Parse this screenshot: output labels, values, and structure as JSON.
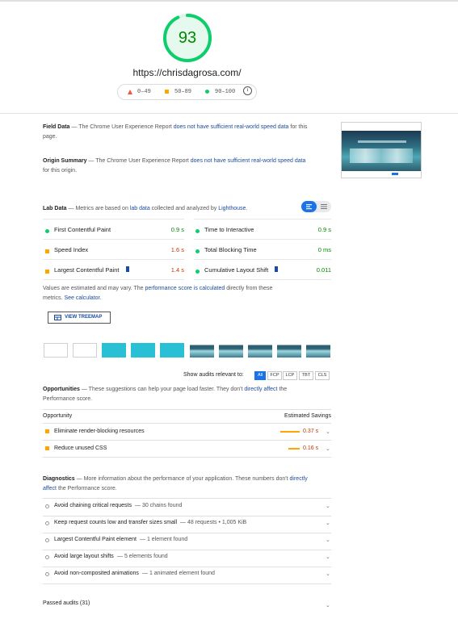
{
  "score": {
    "value": "93",
    "percent": 0.93,
    "color": "#0cce6b"
  },
  "page_url": "https://chrisdagrosa.com/",
  "legend": {
    "fail": "0–49",
    "average": "50–89",
    "pass": "90–100",
    "info_icon": "info-icon"
  },
  "field_data": {
    "title": "Field Data",
    "dash": "—",
    "text": "The Chrome User Experience Report",
    "link": "does not have sufficient real-world speed data",
    "tail": "for this page."
  },
  "origin_summary": {
    "title": "Origin Summary",
    "dash": "—",
    "text": "The Chrome User Experience Report",
    "link": "does not have sufficient real-world speed data",
    "tail": "for this origin."
  },
  "lab_data": {
    "title": "Lab Data",
    "dash": "—",
    "text": "Metrics are based on",
    "link1": "lab data",
    "mid": "collected and analyzed by",
    "link2": "Lighthouse",
    "end": "."
  },
  "metrics": [
    {
      "label": "First Contentful Paint",
      "value": "0.9 s",
      "status": "pass"
    },
    {
      "label": "Time to Interactive",
      "value": "0.9 s",
      "status": "pass"
    },
    {
      "label": "Speed Index",
      "value": "1.6 s",
      "status": "average"
    },
    {
      "label": "Total Blocking Time",
      "value": "0 ms",
      "status": "pass"
    },
    {
      "label": "Largest Contentful Paint",
      "value": "1.4 s",
      "status": "average"
    },
    {
      "label": "Cumulative Layout Shift",
      "value": "0.011",
      "status": "pass"
    }
  ],
  "estimate_note": {
    "a": "Values are estimated and may vary. The",
    "link1": "performance score is calculated",
    "b": "directly from these",
    "c": "metrics.",
    "link2": "See calculator."
  },
  "treemap_button": "VIEW TREEMAP",
  "filter": {
    "label": "Show audits relevant to:",
    "options": [
      "All",
      "FCP",
      "LCP",
      "TBT",
      "CLS"
    ],
    "selected": "All"
  },
  "opportunities": {
    "title": "Opportunities",
    "dash": "—",
    "text": "These suggestions can help your page load faster. They don't",
    "link": "directly affect",
    "tail": "the",
    "tail2": "Performance score.",
    "col_opportunity": "Opportunity",
    "col_savings": "Estimated Savings",
    "items": [
      {
        "label": "Eliminate render-blocking resources",
        "savings": "0.37 s"
      },
      {
        "label": "Reduce unused CSS",
        "savings": "0.16 s"
      }
    ]
  },
  "diagnostics": {
    "title": "Diagnostics",
    "dash": "—",
    "text": "More information about the performance of your application. These numbers don't",
    "link": "directly",
    "link2": "affect",
    "tail": "the Performance score.",
    "items": [
      {
        "label": "Avoid chaining critical requests",
        "detail": "— 30 chains found"
      },
      {
        "label": "Keep request counts low and transfer sizes small",
        "detail": "— 48 requests • 1,005 KiB"
      },
      {
        "label": "Largest Contentful Paint element",
        "detail": "— 1 element found"
      },
      {
        "label": "Avoid large layout shifts",
        "detail": "— 5 elements found"
      },
      {
        "label": "Avoid non-composited animations",
        "detail": "— 1 animated element found"
      }
    ]
  },
  "passed_audits": "Passed audits (31)",
  "colors": {
    "pass": "#0cce6b",
    "average": "#ffa400",
    "fail": "#ff4e42",
    "pass_text": "#008800",
    "average_text": "#c33300",
    "link": "#1a4b9c"
  }
}
